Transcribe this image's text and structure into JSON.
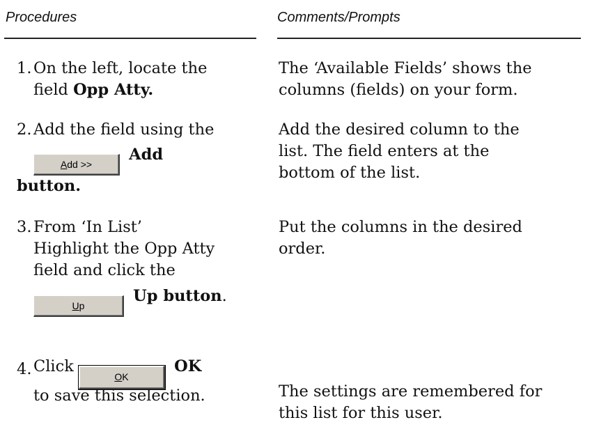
{
  "headers": {
    "procedures": "Procedures",
    "comments": "Comments/Prompts"
  },
  "steps": [
    {
      "num": "1.",
      "line1": "On the left, locate the",
      "line2_pre": "field ",
      "line2_bold": "Opp Atty.",
      "comment_line1": "The ‘Available Fields’ shows the",
      "comment_line2": "columns (fields) on your form."
    },
    {
      "num": "2.",
      "line1": "Add the field using the",
      "button": {
        "accel": "A",
        "rest": "dd >>"
      },
      "after_button": "Add",
      "line3": "button.",
      "comment_line1": "Add the desired column to the",
      "comment_line2": "list. The field enters at the",
      "comment_line3": "bottom of the list."
    },
    {
      "num": "3.",
      "line1": "From ‘In List’",
      "line2": "Highlight the Opp Atty",
      "line3": "field and click the",
      "button": {
        "accel": "U",
        "rest": "p"
      },
      "after_button": "Up button",
      "after_button_tail": ".",
      "comment_line1": "Put the columns in the desired",
      "comment_line2": "order."
    },
    {
      "num": "4.",
      "pre_button": "Click ",
      "button": {
        "accel": "O",
        "rest": "K"
      },
      "after_button": "OK",
      "line2": "to save this selection.",
      "comment_line1": "The settings are remembered for",
      "comment_line2": "this list for this user."
    }
  ]
}
